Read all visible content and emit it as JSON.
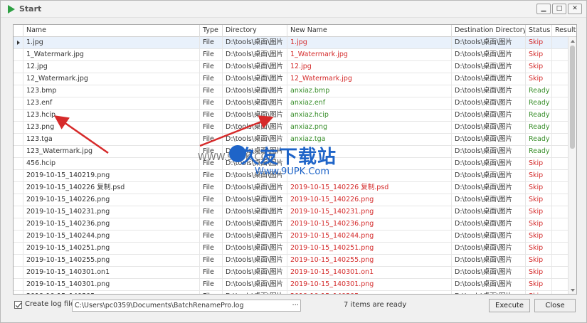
{
  "window": {
    "title": "Start"
  },
  "columns": [
    "Name",
    "Type",
    "Directory",
    "New Name",
    "Destination Directory",
    "Status",
    "Result"
  ],
  "rows": [
    {
      "name": "1.jpg",
      "type": "File",
      "dir": "D:\\tools\\桌面\\图片",
      "new": "1.jpg",
      "dest": "D:\\tools\\桌面\\图片",
      "status": "Skip",
      "result": "",
      "state": "skip"
    },
    {
      "name": "1_Watermark.jpg",
      "type": "File",
      "dir": "D:\\tools\\桌面\\图片",
      "new": "1_Watermark.jpg",
      "dest": "D:\\tools\\桌面\\图片",
      "status": "Skip",
      "result": "",
      "state": "skip"
    },
    {
      "name": "12.jpg",
      "type": "File",
      "dir": "D:\\tools\\桌面\\图片",
      "new": "12.jpg",
      "dest": "D:\\tools\\桌面\\图片",
      "status": "Skip",
      "result": "",
      "state": "skip"
    },
    {
      "name": "12_Watermark.jpg",
      "type": "File",
      "dir": "D:\\tools\\桌面\\图片",
      "new": "12_Watermark.jpg",
      "dest": "D:\\tools\\桌面\\图片",
      "status": "Skip",
      "result": "",
      "state": "skip"
    },
    {
      "name": "123.bmp",
      "type": "File",
      "dir": "D:\\tools\\桌面\\图片",
      "new": "anxiaz.bmp",
      "dest": "D:\\tools\\桌面\\图片",
      "status": "Ready",
      "result": "",
      "state": "ready"
    },
    {
      "name": "123.enf",
      "type": "File",
      "dir": "D:\\tools\\桌面\\图片",
      "new": "anxiaz.enf",
      "dest": "D:\\tools\\桌面\\图片",
      "status": "Ready",
      "result": "",
      "state": "ready"
    },
    {
      "name": "123.hcip",
      "type": "File",
      "dir": "D:\\tools\\桌面\\图片",
      "new": "anxiaz.hcip",
      "dest": "D:\\tools\\桌面\\图片",
      "status": "Ready",
      "result": "",
      "state": "ready"
    },
    {
      "name": "123.png",
      "type": "File",
      "dir": "D:\\tools\\桌面\\图片",
      "new": "anxiaz.png",
      "dest": "D:\\tools\\桌面\\图片",
      "status": "Ready",
      "result": "",
      "state": "ready"
    },
    {
      "name": "123.tga",
      "type": "File",
      "dir": "D:\\tools\\桌面\\图片",
      "new": "anxiaz.tga",
      "dest": "D:\\tools\\桌面\\图片",
      "status": "Ready",
      "result": "",
      "state": "ready"
    },
    {
      "name": "123_Watermark.jpg",
      "type": "File",
      "dir": "D:\\tools\\桌面\\图片",
      "new": "",
      "dest": "D:\\tools\\桌面\\图片",
      "status": "Ready",
      "result": "",
      "state": "ready"
    },
    {
      "name": "456.hcip",
      "type": "File",
      "dir": "D:\\tools\\桌面\\图片",
      "new": "",
      "dest": "D:\\tools\\桌面\\图片",
      "status": "Skip",
      "result": "",
      "state": "skip"
    },
    {
      "name": "2019-10-15_140219.png",
      "type": "File",
      "dir": "D:\\tools\\桌面\\图片",
      "new": "",
      "dest": "D:\\tools\\桌面\\图片",
      "status": "Skip",
      "result": "",
      "state": "skip"
    },
    {
      "name": "2019-10-15_140226 复制.psd",
      "type": "File",
      "dir": "D:\\tools\\桌面\\图片",
      "new": "2019-10-15_140226 复制.psd",
      "dest": "D:\\tools\\桌面\\图片",
      "status": "Skip",
      "result": "",
      "state": "skip"
    },
    {
      "name": "2019-10-15_140226.png",
      "type": "File",
      "dir": "D:\\tools\\桌面\\图片",
      "new": "2019-10-15_140226.png",
      "dest": "D:\\tools\\桌面\\图片",
      "status": "Skip",
      "result": "",
      "state": "skip"
    },
    {
      "name": "2019-10-15_140231.png",
      "type": "File",
      "dir": "D:\\tools\\桌面\\图片",
      "new": "2019-10-15_140231.png",
      "dest": "D:\\tools\\桌面\\图片",
      "status": "Skip",
      "result": "",
      "state": "skip"
    },
    {
      "name": "2019-10-15_140236.png",
      "type": "File",
      "dir": "D:\\tools\\桌面\\图片",
      "new": "2019-10-15_140236.png",
      "dest": "D:\\tools\\桌面\\图片",
      "status": "Skip",
      "result": "",
      "state": "skip"
    },
    {
      "name": "2019-10-15_140244.png",
      "type": "File",
      "dir": "D:\\tools\\桌面\\图片",
      "new": "2019-10-15_140244.png",
      "dest": "D:\\tools\\桌面\\图片",
      "status": "Skip",
      "result": "",
      "state": "skip"
    },
    {
      "name": "2019-10-15_140251.png",
      "type": "File",
      "dir": "D:\\tools\\桌面\\图片",
      "new": "2019-10-15_140251.png",
      "dest": "D:\\tools\\桌面\\图片",
      "status": "Skip",
      "result": "",
      "state": "skip"
    },
    {
      "name": "2019-10-15_140255.png",
      "type": "File",
      "dir": "D:\\tools\\桌面\\图片",
      "new": "2019-10-15_140255.png",
      "dest": "D:\\tools\\桌面\\图片",
      "status": "Skip",
      "result": "",
      "state": "skip"
    },
    {
      "name": "2019-10-15_140301.on1",
      "type": "File",
      "dir": "D:\\tools\\桌面\\图片",
      "new": "2019-10-15_140301.on1",
      "dest": "D:\\tools\\桌面\\图片",
      "status": "Skip",
      "result": "",
      "state": "skip"
    },
    {
      "name": "2019-10-15_140301.png",
      "type": "File",
      "dir": "D:\\tools\\桌面\\图片",
      "new": "2019-10-15_140301.png",
      "dest": "D:\\tools\\桌面\\图片",
      "status": "Skip",
      "result": "",
      "state": "skip"
    },
    {
      "name": "2019-10-15_140305.png",
      "type": "File",
      "dir": "D:\\tools\\桌面\\图片",
      "new": "2019-10-15_140305.png",
      "dest": "D:\\tools\\桌面\\图片",
      "status": "Skip",
      "result": "",
      "state": "skip"
    }
  ],
  "footer": {
    "log_label": "Create log file:",
    "log_path": "C:\\Users\\pc0359\\Documents\\BatchRenamePro.log",
    "browse": "···",
    "status": "7 items are ready",
    "execute": "Execute",
    "close": "Close"
  },
  "watermark": {
    "main": "久友下载站",
    "url": "Www.9UPK.Com",
    "side": "WWW.9UPK.COM"
  },
  "colors": {
    "skip": "#d42b2b",
    "ready": "#3a8f2c",
    "accent": "#1e64c8"
  }
}
